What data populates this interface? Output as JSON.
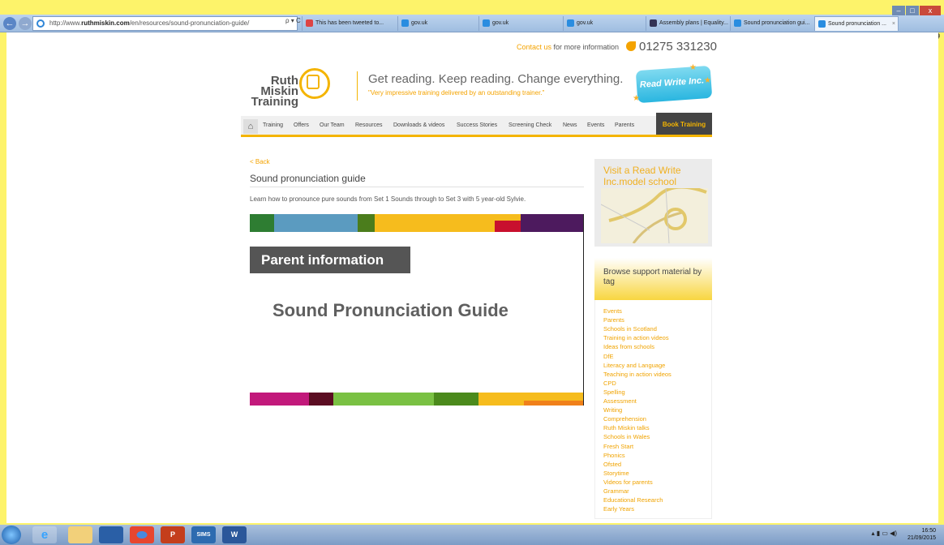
{
  "browser": {
    "address_prefix": "http://www.",
    "address_domain": "ruthmiskin.com",
    "address_path": "/en/resources/sound-pronunciation-guide/",
    "addr_ctrl": "ρ ▾ C",
    "tabs": [
      {
        "label": "This has been tweeted to...",
        "icon_color": "#d44"
      },
      {
        "label": "gov.uk",
        "icon_color": "#2a8de0"
      },
      {
        "label": "gov.uk",
        "icon_color": "#2a8de0"
      },
      {
        "label": "gov.uk",
        "icon_color": "#2a8de0"
      },
      {
        "label": "Assembly plans | Equality...",
        "icon_color": "#335"
      },
      {
        "label": "Sound pronunciation gui...",
        "icon_color": "#2a8de0"
      },
      {
        "label": "Sound pronunciation ...",
        "icon_color": "#2a8de0"
      }
    ],
    "close_tab": "×",
    "win_min": "–",
    "win_max": "□",
    "win_close": "x",
    "toolbar_icons": "⌂ ★ ⚙"
  },
  "header": {
    "contact_link": "Contact us",
    "contact_rest": " for more information",
    "phone": "01275 331230",
    "logo_line1": "Ruth Miskin",
    "logo_line2": "Training",
    "tagline": "Get reading. Keep reading. Change everything.",
    "tagquote": "\"Very impressive training delivered by an outstanding trainer.\"",
    "rwi_label": "Read Write Inc."
  },
  "nav": {
    "home_icon": "⌂",
    "items": [
      "Training",
      "Offers",
      "Our Team",
      "Resources",
      "Downloads & videos",
      "Success Stories",
      "Screening Check",
      "News",
      "Events",
      "Parents"
    ],
    "book": "Book Training"
  },
  "main": {
    "back": "< Back",
    "title": "Sound pronunciation guide",
    "intro": "Learn how to pronounce pure sounds from Set 1 Sounds through to Set 3 with 5 year-old Sylvie.",
    "video_badge": "Parent information",
    "video_title": "Sound Pronunciation Guide"
  },
  "sidebar": {
    "visit_title": "Visit a Read Write Inc.model school",
    "browse_title": "Browse support material by tag",
    "tags": [
      "Events",
      "Parents",
      "Schools in Scotland",
      "Training in action videos",
      "Ideas from schools",
      "DfE",
      "Literacy and Language",
      "Teaching in action videos",
      "CPD",
      "Spelling",
      "Assessment",
      "Writing",
      "Comprehension",
      "Ruth Miskin talks",
      "Schools in Wales",
      "Fresh Start",
      "Phonics",
      "Ofsted",
      "Storytime",
      "Videos for parents",
      "Grammar",
      "Educational Research",
      "Early Years"
    ]
  },
  "taskbar": {
    "apps": [
      "",
      "e",
      "",
      "",
      "",
      "P",
      "SIMS",
      "W"
    ],
    "time": "16:50",
    "date": "21/09/2015",
    "tray": "▴ ▮ ▭ ◀)"
  },
  "colors": {
    "accent": "#f4b400",
    "link": "#f4a300",
    "page_bg": "#fdf36a"
  }
}
